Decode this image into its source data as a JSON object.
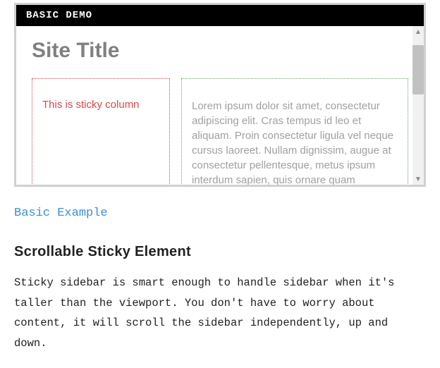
{
  "demo": {
    "header": "BASIC DEMO",
    "site_title": "Site Title",
    "sticky_text": "This is sticky column",
    "lorem": "Lorem ipsum dolor sit amet, consectetur adipiscing elit. Cras tempus id leo et aliquam. Proin consectetur ligula vel neque cursus laoreet. Nullam dignissim, augue at consectetur pellentesque, metus ipsum interdum sapien, quis ornare quam"
  },
  "link_label": "Basic Example",
  "section_heading": "Scrollable Sticky Element",
  "body_paragraph": "Sticky sidebar is smart enough to handle sidebar when it's taller than the viewport. You don't have to worry about content, it will scroll the sidebar independently, up and down."
}
